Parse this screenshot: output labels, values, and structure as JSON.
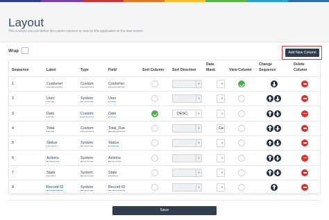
{
  "colors": {
    "rainbow": [
      "#2d3b8c",
      "#7b3fa0",
      "#c43a3a",
      "#e07b2a",
      "#f2c12e",
      "#5fb348",
      "#2fa3c7",
      "#2d6fb7"
    ],
    "primary_button": "#2f3d4e",
    "highlight": "#d93a3a",
    "success": "#48b04b",
    "danger": "#e02e2e"
  },
  "header": {
    "title": "Layout",
    "description": "This is where you can define the custom columns to view for this application on the data screen."
  },
  "wrap": {
    "label": "Wrap",
    "checked": false
  },
  "add_button": {
    "label": "Add New Column"
  },
  "columns": {
    "sequence": "Sequence",
    "label": "Label",
    "type": "Type",
    "field": "Field",
    "sort_column": "Sort Column",
    "sort_direction": "Sort Direction",
    "data_mask_1": "Data",
    "data_mask_2": "Mask",
    "view_column": "View Column",
    "change_sequence_1": "Change",
    "change_sequence_2": "Sequence",
    "delete_column_1": "Delete",
    "delete_column_2": "Column"
  },
  "rows": [
    {
      "sequence": "1",
      "label": "Customer",
      "type": "Custom",
      "field": "Customer",
      "sort": false,
      "direction": "",
      "mask": "",
      "view": true,
      "up": false,
      "down": true
    },
    {
      "sequence": "2",
      "label": "User",
      "type": "System",
      "field": "User",
      "sort": false,
      "direction": "",
      "mask": "",
      "view": false,
      "up": true,
      "down": true
    },
    {
      "sequence": "3",
      "label": "Date",
      "type": "Custom",
      "field": "Date",
      "sort": true,
      "direction": "DESC",
      "mask": "",
      "view": false,
      "up": true,
      "down": true
    },
    {
      "sequence": "4",
      "label": "Total",
      "type": "Custom",
      "field": "Total_Due",
      "sort": false,
      "direction": "",
      "mask": "Cu",
      "view": false,
      "up": true,
      "down": true
    },
    {
      "sequence": "5",
      "label": "Status",
      "type": "System",
      "field": "Status",
      "sort": false,
      "direction": "",
      "mask": "",
      "view": false,
      "up": true,
      "down": true
    },
    {
      "sequence": "6",
      "label": "Actions",
      "type": "System",
      "field": "Actions",
      "sort": false,
      "direction": "",
      "mask": "",
      "view": false,
      "up": true,
      "down": true
    },
    {
      "sequence": "7",
      "label": "State",
      "type": "System",
      "field": "State",
      "sort": false,
      "direction": "",
      "mask": "",
      "view": false,
      "up": true,
      "down": true
    },
    {
      "sequence": "8",
      "label": "Record ID",
      "type": "System",
      "field": "Record ID",
      "sort": false,
      "direction": "",
      "mask": "",
      "view": false,
      "up": true,
      "down": false
    }
  ],
  "save_button": {
    "label": "Save"
  }
}
